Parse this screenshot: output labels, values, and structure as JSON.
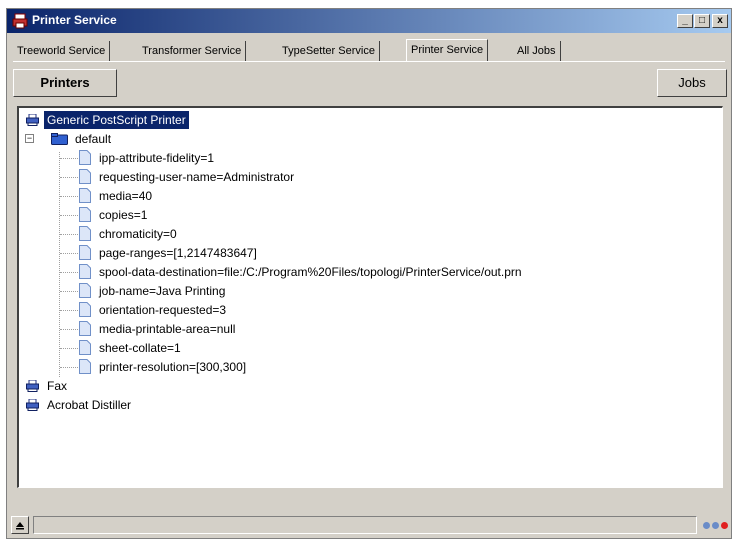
{
  "window": {
    "title": "Printer Service",
    "min_label": "_",
    "max_label": "□",
    "close_label": "x"
  },
  "tabs": [
    {
      "label": "Treeworld Service",
      "active": false
    },
    {
      "label": "Transformer Service",
      "active": false
    },
    {
      "label": "TypeSetter Service",
      "active": false
    },
    {
      "label": "Printer Service",
      "active": true
    },
    {
      "label": "All Jobs",
      "active": false
    }
  ],
  "toolbar": {
    "printers_label": "Printers",
    "jobs_label": "Jobs"
  },
  "tree": {
    "selected_printer": "Generic PostScript Printer",
    "folder_label": "default",
    "expander_label": "−",
    "attributes": [
      "ipp-attribute-fidelity=1",
      "requesting-user-name=Administrator",
      "media=40",
      "copies=1",
      "chromaticity=0",
      "page-ranges=[1,2147483647]",
      "spool-data-destination=file:/C:/Program%20Files/topologi/PrinterService/out.prn",
      "job-name=Java Printing",
      "orientation-requested=3",
      "media-printable-area=null",
      "sheet-collate=1",
      "printer-resolution=[300,300]"
    ],
    "other_printers": [
      "Fax",
      "Acrobat Distiller"
    ]
  },
  "status": {
    "indicator_colors": [
      "#6a8cc8",
      "#6a8cc8",
      "#e02020"
    ]
  },
  "colors": {
    "selection": "#0a246a",
    "titlebar": "#0a246a"
  }
}
